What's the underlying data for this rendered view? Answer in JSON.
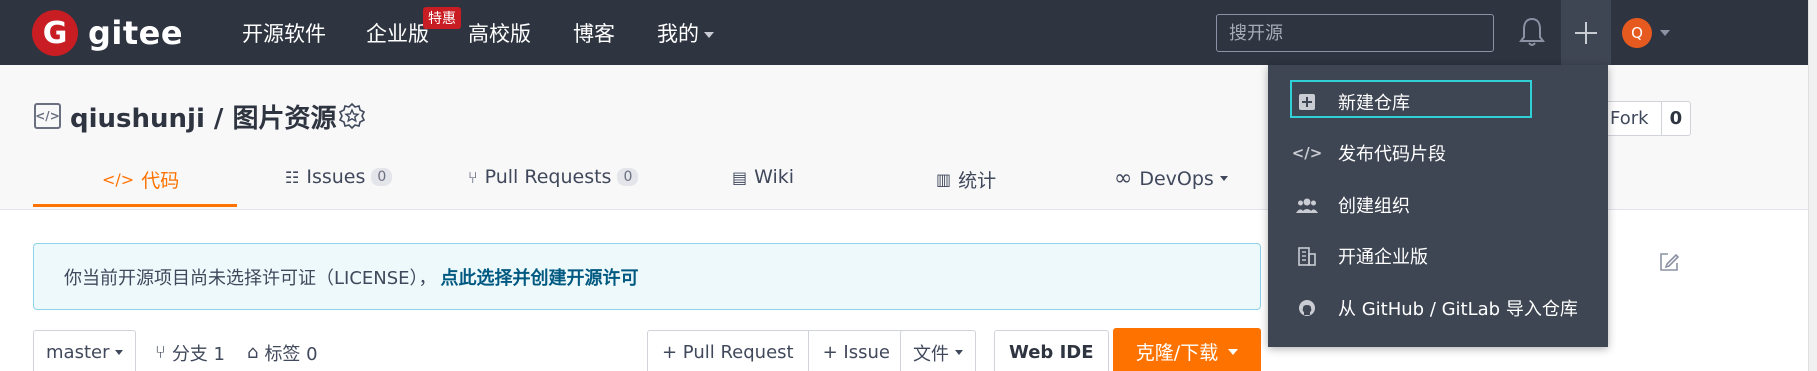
{
  "nav": {
    "logo_text": "gitee",
    "logo_letter": "G",
    "items": [
      "开源软件",
      "企业版",
      "高校版",
      "博客",
      "我的"
    ],
    "promo_badge": "特惠",
    "search_placeholder": "搜开源",
    "avatar_letter": "Q"
  },
  "repo": {
    "title": "qiushunji / 图片资源",
    "fork_label": "Fork",
    "fork_count": "0"
  },
  "tabs": {
    "code": "代码",
    "issues": "Issues",
    "issues_count": "0",
    "pulls": "Pull Requests",
    "pulls_count": "0",
    "wiki": "Wiki",
    "stats": "统计",
    "devops": "DevOps"
  },
  "license": {
    "text": "你当前开源项目尚未选择许可证（LICENSE），",
    "link": "点此选择并创建开源许可"
  },
  "toolbar": {
    "branch": "master",
    "branches": "分支 1",
    "tags": "标签 0",
    "new_pr": "+ Pull Request",
    "new_issue": "+ Issue",
    "files": "文件",
    "web_ide": "Web IDE",
    "clone": "克隆/下载"
  },
  "dropdown": {
    "items": [
      {
        "label": "新建仓库",
        "icon": "plus-square-icon"
      },
      {
        "label": "发布代码片段",
        "icon": "code-icon"
      },
      {
        "label": "创建组织",
        "icon": "group-icon"
      },
      {
        "label": "开通企业版",
        "icon": "building-icon"
      },
      {
        "label": "从 GitHub / GitLab 导入仓库",
        "icon": "github-icon"
      }
    ]
  },
  "colors": {
    "nav_bg": "#2e3440",
    "accent": "#fe7300",
    "brand_red": "#c71d23",
    "highlight": "#2fd1d6"
  }
}
